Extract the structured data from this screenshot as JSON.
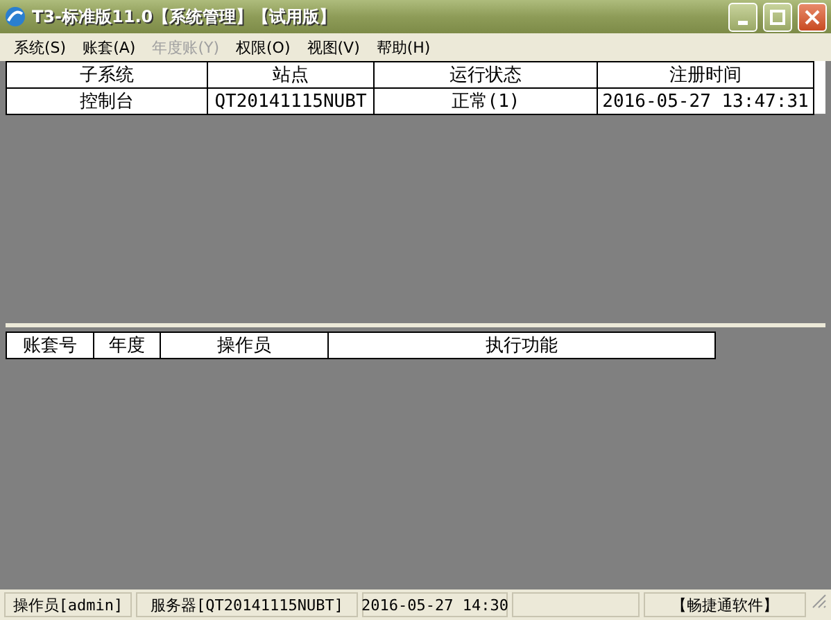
{
  "window": {
    "title": "T3-标准版11.0【系统管理】【试用版】"
  },
  "menu": [
    {
      "label": "系统(S)",
      "disabled": false
    },
    {
      "label": "账套(A)",
      "disabled": false
    },
    {
      "label": "年度账(Y)",
      "disabled": true
    },
    {
      "label": "权限(O)",
      "disabled": false
    },
    {
      "label": "视图(V)",
      "disabled": false
    },
    {
      "label": "帮助(H)",
      "disabled": false
    }
  ],
  "subsystems": {
    "columns": [
      "子系统",
      "站点",
      "运行状态",
      "注册时间"
    ],
    "rows": [
      [
        "控制台",
        "QT20141115NUBT",
        "正常(1)",
        "2016-05-27 13:47:31"
      ]
    ]
  },
  "tasks": {
    "columns": [
      "账套号",
      "年度",
      "操作员",
      "执行功能"
    ]
  },
  "status_bar": [
    "操作员[admin]",
    "服务器[QT20141115NUBT]",
    "2016-05-27 14:30",
    "【畅捷通软件】"
  ]
}
